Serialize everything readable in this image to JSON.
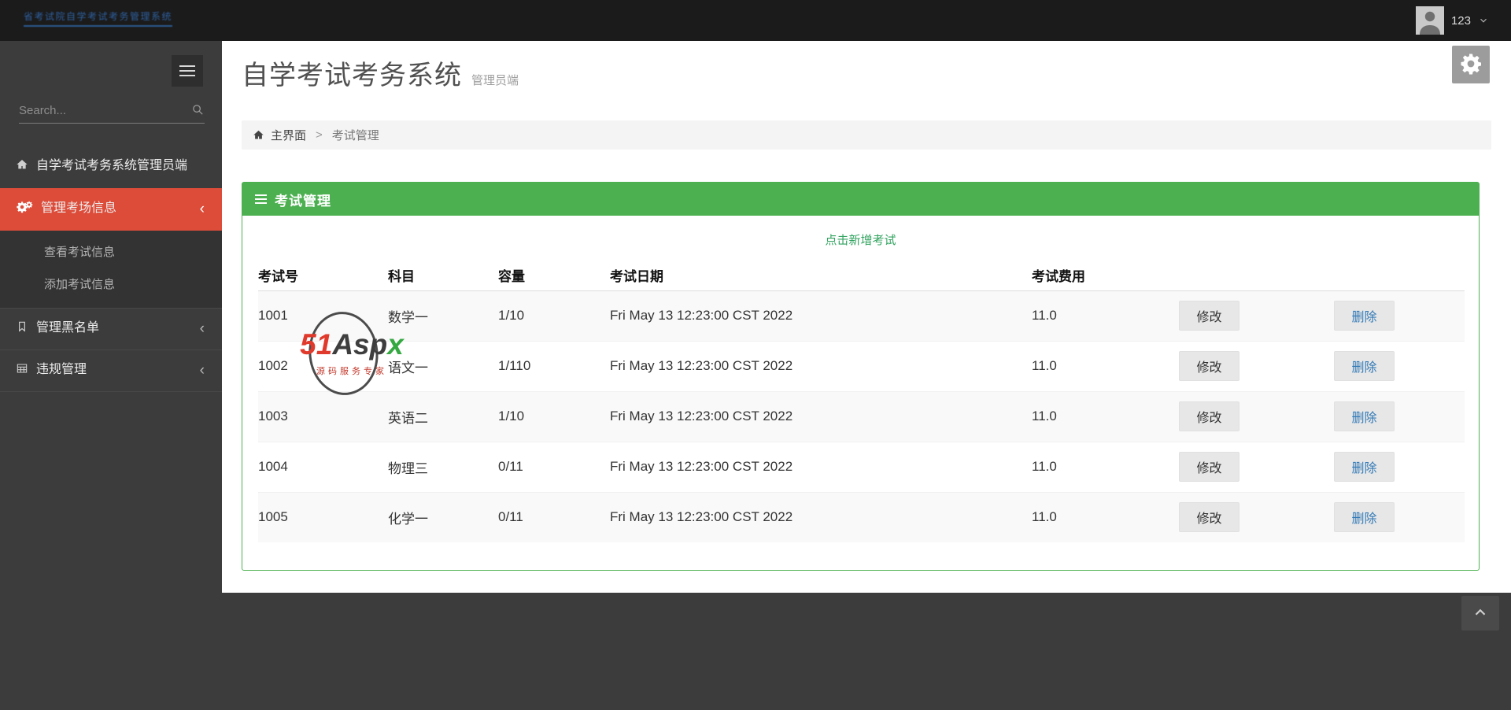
{
  "topbar": {
    "logo_text": "省考试院自学考试考务管理系统",
    "user_name": "123"
  },
  "sidebar": {
    "search_placeholder": "Search...",
    "items": [
      {
        "label": "自学考试考务系统管理员端",
        "icon": "home-icon"
      },
      {
        "label": "管理考场信息",
        "icon": "cogs-icon",
        "active": true,
        "children": [
          "查看考试信息",
          "添加考试信息"
        ]
      },
      {
        "label": "管理黑名单",
        "icon": "bookmark-icon"
      },
      {
        "label": "违规管理",
        "icon": "table-icon"
      }
    ]
  },
  "header": {
    "title": "自学考试考务系统",
    "subtitle": "管理员端"
  },
  "breadcrumb": {
    "home": "主界面",
    "separator": ">",
    "current": "考试管理"
  },
  "panel": {
    "title": "考试管理",
    "add_link": "点击新增考试"
  },
  "table": {
    "headers": [
      "考试号",
      "科目",
      "容量",
      "考试日期",
      "考试费用"
    ],
    "edit_label": "修改",
    "delete_label": "删除",
    "rows": [
      {
        "id": "1001",
        "subject": "数学一",
        "capacity": "1/10",
        "date": "Fri May 13 12:23:00 CST 2022",
        "fee": "11.0"
      },
      {
        "id": "1002",
        "subject": "语文一",
        "capacity": "1/110",
        "date": "Fri May 13 12:23:00 CST 2022",
        "fee": "11.0"
      },
      {
        "id": "1003",
        "subject": "英语二",
        "capacity": "1/10",
        "date": "Fri May 13 12:23:00 CST 2022",
        "fee": "11.0"
      },
      {
        "id": "1004",
        "subject": "物理三",
        "capacity": "0/11",
        "date": "Fri May 13 12:23:00 CST 2022",
        "fee": "11.0"
      },
      {
        "id": "1005",
        "subject": "化学一",
        "capacity": "0/11",
        "date": "Fri May 13 12:23:00 CST 2022",
        "fee": "11.0"
      }
    ]
  },
  "watermark": {
    "part_51": "51",
    "part_asp": "Asp",
    "part_x": "x",
    "tagline": "源码服务专家"
  },
  "icons": {
    "chevron_left": "‹"
  },
  "colors": {
    "topbar_bg": "#1b1b1b",
    "sidebar_bg": "#3c3c3c",
    "sidebar_active_red": "#dd4b39",
    "accent_green": "#4cb050",
    "add_link_green": "#31a35f",
    "delete_link_blue": "#337ab7",
    "breadcrumb_bg": "#f4f4f4"
  }
}
